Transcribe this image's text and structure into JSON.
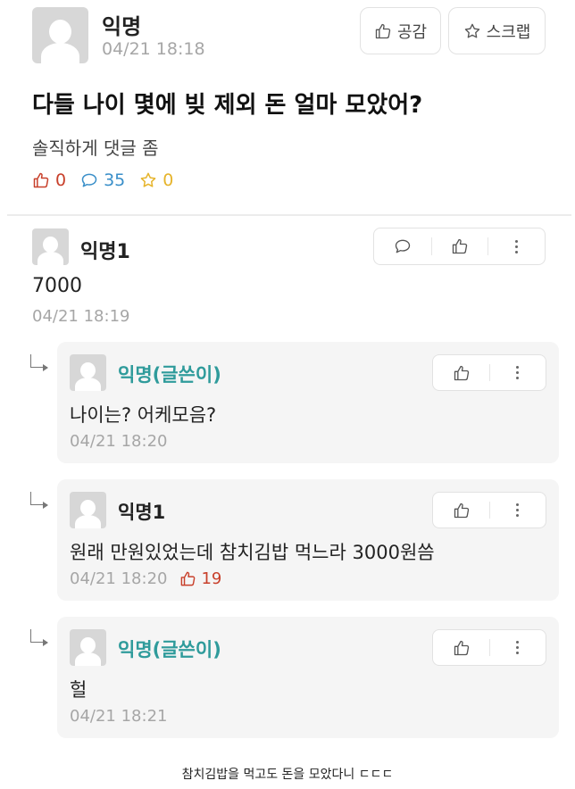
{
  "post": {
    "author": "익명",
    "timestamp": "04/21 18:18",
    "like_button": "공감",
    "scrap_button": "스크랩",
    "title": "다들 나이 몇에 빚 제외 돈 얼마 모았어?",
    "body": "솔직하게 댓글 좀",
    "stats": {
      "likes": "0",
      "comments": "35",
      "scraps": "0"
    }
  },
  "comments": [
    {
      "author": "익명1",
      "text": "7000",
      "time": "04/21 18:19"
    }
  ],
  "replies": [
    {
      "author": "익명(글쓴이)",
      "text": "나이는? 어케모음?",
      "time": "04/21 18:20",
      "is_op": true
    },
    {
      "author": "익명1",
      "text": "원래 만원있었는데 참치김밥 먹느라 3000원씀",
      "time": "04/21 18:20",
      "likes": "19",
      "is_op": false
    },
    {
      "author": "익명(글쓴이)",
      "text": "헐",
      "time": "04/21 18:21",
      "is_op": true
    }
  ],
  "caption": "참치김밥을 먹고도 돈을 모았다니 ㄷㄷㄷ",
  "colors": {
    "like_red": "#c8402b",
    "comment_blue": "#3a8fc9",
    "scrap_yellow": "#e6b42c",
    "op_teal": "#2f9b9b"
  }
}
